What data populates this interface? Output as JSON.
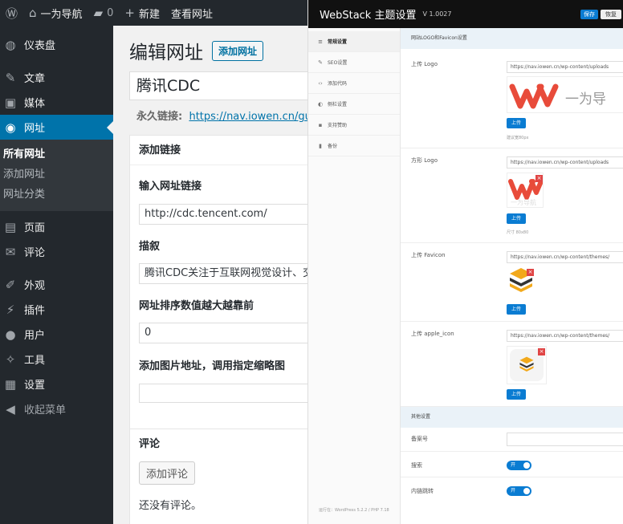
{
  "wp": {
    "adminbar": {
      "site_name": "一为导航",
      "comment_count": "0",
      "new_label": "新建",
      "view_label": "查看网址"
    },
    "menu": [
      {
        "label": "仪表盘",
        "icon": "dashboard-icon",
        "glyph": "◍"
      },
      {
        "label": "文章",
        "icon": "pin-icon",
        "glyph": "✎"
      },
      {
        "label": "媒体",
        "icon": "media-icon",
        "glyph": "▣"
      },
      {
        "label": "网址",
        "icon": "globe-icon",
        "glyph": "◉",
        "current": true
      }
    ],
    "submenu": [
      "所有网址",
      "添加网址",
      "网址分类"
    ],
    "menu2": [
      {
        "label": "页面",
        "icon": "page-icon",
        "glyph": "▤"
      },
      {
        "label": "评论",
        "icon": "comment-icon",
        "glyph": "✉"
      },
      {
        "label": "外观",
        "icon": "brush-icon",
        "glyph": "✐"
      },
      {
        "label": "插件",
        "icon": "plugin-icon",
        "glyph": "⚡"
      },
      {
        "label": "用户",
        "icon": "user-icon",
        "glyph": "●"
      },
      {
        "label": "工具",
        "icon": "wrench-icon",
        "glyph": "✧"
      },
      {
        "label": "设置",
        "icon": "settings-icon",
        "glyph": "▦"
      },
      {
        "label": "收起菜单",
        "icon": "collapse-icon",
        "glyph": "◀"
      }
    ],
    "page_title": "编辑网址",
    "add_button": "添加网址",
    "post_title": "腾讯CDC",
    "permalink_label": "永久链接:",
    "permalink_url": "https://nav.iowen.cn/guide/t",
    "add_link_box": {
      "title": "添加链接",
      "url_label": "输入网址链接",
      "url_value": "http://cdc.tencent.com/",
      "desc_label": "描叙",
      "desc_value": "腾讯CDC关注于互联网视觉设计、交",
      "order_label": "网址排序数值越大越靠前",
      "order_value": "0",
      "image_label": "添加图片地址，调用指定缩略图",
      "image_value": ""
    },
    "comments_box": {
      "title": "评论",
      "add_button": "添加评论",
      "empty_text": "还没有评论。"
    }
  },
  "ws": {
    "title": "WebStack 主题设置",
    "version": "V 1.0027",
    "save_label": "保存",
    "reset_label": "恢复",
    "nav": [
      {
        "label": "常规设置",
        "glyph": "≡",
        "icon": "list-icon",
        "active": true
      },
      {
        "label": "SEO设置",
        "glyph": "✎",
        "icon": "pen-icon"
      },
      {
        "label": "添加代码",
        "glyph": "‹›",
        "icon": "code-icon"
      },
      {
        "label": "侧栏设置",
        "glyph": "◐",
        "icon": "sidebar-icon"
      },
      {
        "label": "支持赞助",
        "glyph": "▪",
        "icon": "donate-icon"
      },
      {
        "label": "备份",
        "glyph": "▮",
        "icon": "backup-icon"
      }
    ],
    "section1": "网站LOGO和Favicon设置",
    "logo": {
      "label": "上传 Logo",
      "url": "https://nav.iowen.cn/wp-content/uploads",
      "button": "上传",
      "hint": "建议宽80px",
      "thumb_text": "一为导"
    },
    "square_logo": {
      "label": "方形 Logo",
      "url": "https://nav.iowen.cn/wp-content/uploads",
      "button": "上传",
      "hint": "尺寸 80x80",
      "thumb_text": "一为导航"
    },
    "favicon": {
      "label": "上传 Favicon",
      "url": "https://nav.iowen.cn/wp-content/themes/",
      "button": "上传"
    },
    "apple_icon": {
      "label": "上传 apple_icon",
      "url": "https://nav.iowen.cn/wp-content/themes/",
      "button": "上传"
    },
    "section2": "其他设置",
    "record_label": "备案号",
    "search_label": "搜索",
    "search_toggle": "开",
    "redirect_label": "内链跳转",
    "redirect_toggle": "开",
    "footer": "运行在：WordPress 5.2.2 / PHP 7.18",
    "colors": {
      "brand_red": "#e84b3a",
      "accent_blue": "#0a7cd2",
      "wp_blue": "#0073aa"
    }
  }
}
